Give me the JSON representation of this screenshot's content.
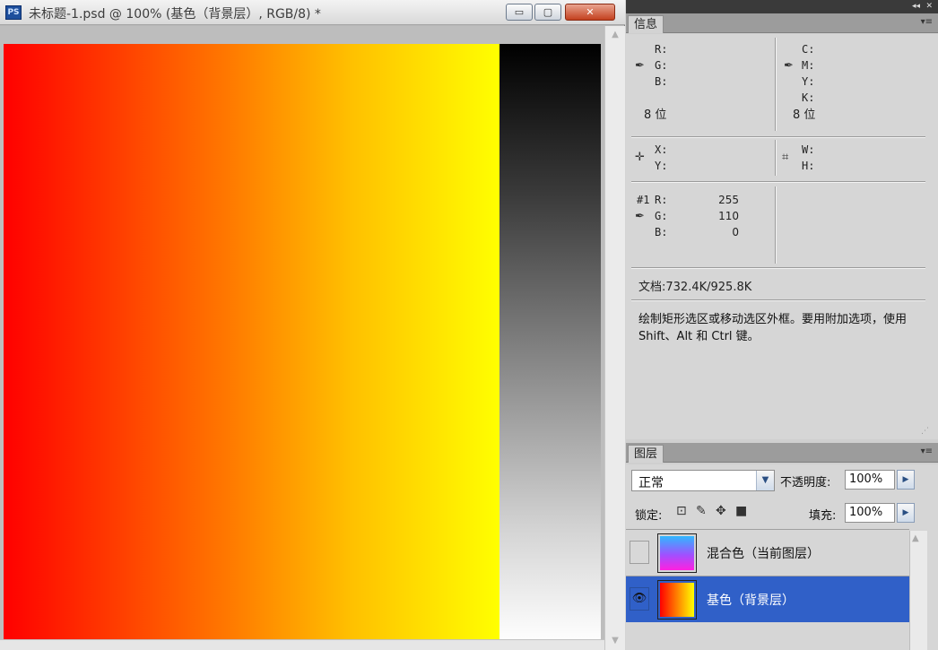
{
  "document": {
    "app_icon": "PS",
    "title": "未标题-1.psd @ 100% (基色（背景层）, RGB/8) *",
    "window_buttons": {
      "minimize": "▭",
      "maximize": "▢",
      "close": "✕"
    }
  },
  "colors": {
    "gradient_left": "#ff0000",
    "gradient_right": "#ffff00",
    "gray_top": "#000000",
    "gray_bottom": "#ffffff",
    "selected_layer": "#3060c8"
  },
  "dock": {
    "collapse": "◂◂",
    "close": "✕"
  },
  "info_panel": {
    "tab": "信息",
    "menu": "▾≡",
    "rgb": {
      "r": "R:",
      "g": "G:",
      "b": "B:",
      "bits": "8 位",
      "icon": "eyedropper-icon"
    },
    "cmyk": {
      "c": "C:",
      "m": "M:",
      "y": "Y:",
      "k": "K:",
      "bits": "8 位",
      "icon": "eyedropper-icon"
    },
    "position": {
      "x": "X:",
      "y": "Y:",
      "icon": "crosshair-icon"
    },
    "dimensions": {
      "w": "W:",
      "h": "H:",
      "icon": "marquee-icon"
    },
    "sampler": {
      "label": "#1",
      "r_label": "R:",
      "g_label": "G:",
      "b_label": "B:",
      "r": "255",
      "g": "110",
      "b": "0"
    },
    "doc_size": "文档:732.4K/925.8K",
    "hint": "绘制矩形选区或移动选区外框。要用附加选项，使用 Shift、Alt 和 Ctrl 键。"
  },
  "layers_panel": {
    "tab": "图层",
    "menu": "▾≡",
    "blend_mode": "正常",
    "opacity_label": "不透明度:",
    "opacity": "100%",
    "lock_label": "锁定:",
    "fill_label": "填充:",
    "fill": "100%",
    "layers": [
      {
        "name": "混合色（当前图层）",
        "visible": false,
        "selected": false
      },
      {
        "name": "基色（背景层）",
        "visible": true,
        "selected": true
      }
    ]
  }
}
